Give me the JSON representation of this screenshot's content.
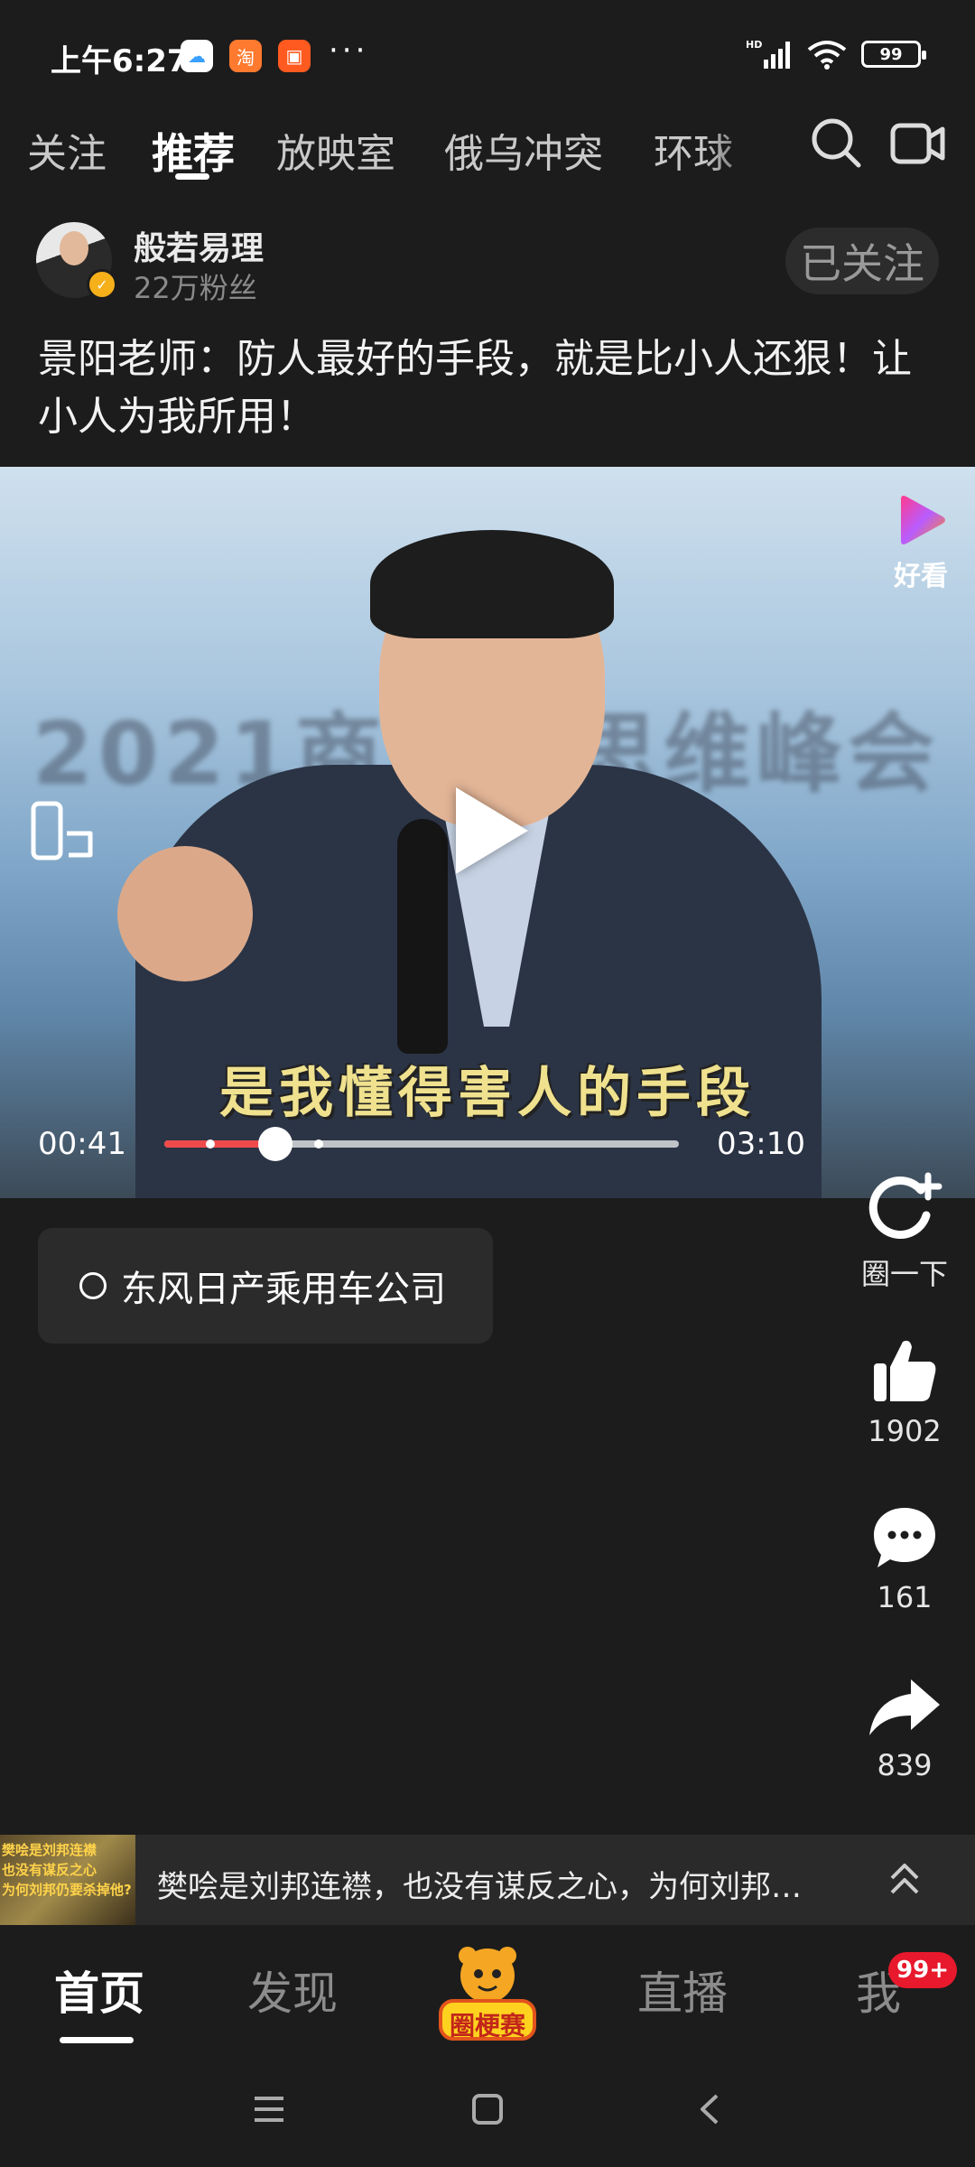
{
  "status_bar": {
    "time": "上午6:27",
    "more": "···",
    "battery": "99",
    "network": "HD"
  },
  "top_tabs": {
    "items": [
      "关注",
      "推荐",
      "放映室",
      "俄乌冲突",
      "环球"
    ],
    "active": "推荐"
  },
  "author": {
    "name": "般若易理",
    "fans": "22万粉丝",
    "follow_label": "已关注"
  },
  "post": {
    "title": "景阳老师：防人最好的手段，就是比小人还狠！让小人为我所用！"
  },
  "video": {
    "background_text": "2021商业…思维峰会",
    "subtitle": "是我懂得害人的手段",
    "current_time": "00:41",
    "total_time": "03:10",
    "progress": 0.216,
    "buffer_markers": [
      0.09,
      0.3
    ],
    "source_label": "好看"
  },
  "tag": {
    "label": "东风日产乘用车公司"
  },
  "actions": {
    "share_circle_label": "圈一下",
    "like_count": "1902",
    "comment_count": "161",
    "share_count": "839"
  },
  "related": {
    "text": "樊哙是刘邦连襟，也没有谋反之心，为何刘邦…",
    "thumb_lines": [
      "樊哙是刘邦连襟",
      "也没有谋反之心",
      "为何刘邦仍要杀掉他?"
    ]
  },
  "bottom_nav": {
    "items": [
      "首页",
      "发现",
      "直播",
      "我"
    ],
    "center_label": "圈梗赛",
    "badge": "99+"
  },
  "colors": {
    "background": "#1c1c1c",
    "accent_red": "#f04b4b",
    "badge_red": "#e8192c",
    "subtitle_yellow": "#efe18e"
  }
}
